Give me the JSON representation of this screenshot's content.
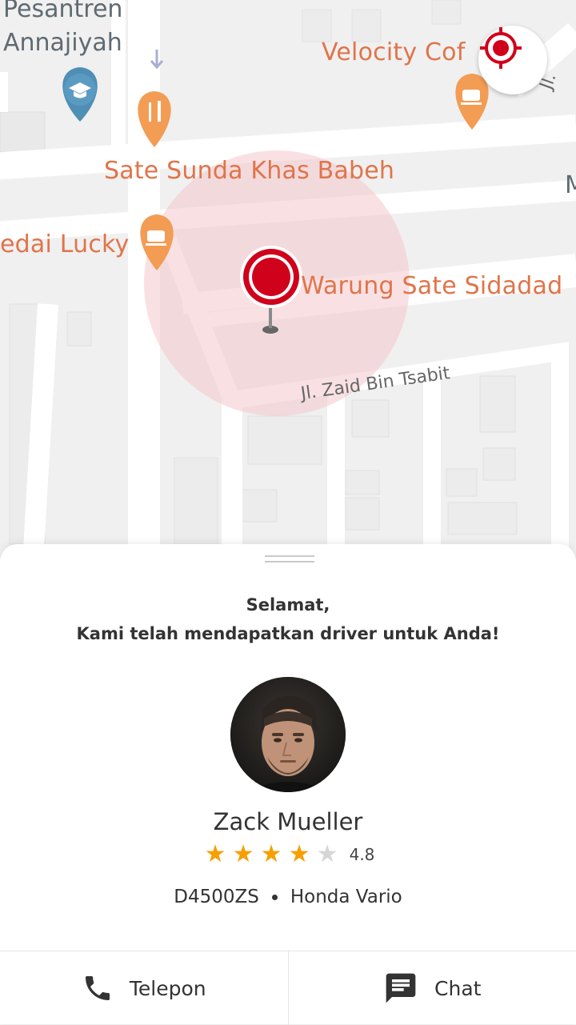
{
  "map": {
    "poi_labels": [
      "Pesantren",
      "Annajiyah",
      "Velocity Cof",
      "Sate Sunda Khas Babeh",
      "edai Lucky",
      "Warung Sate Sidadad",
      "M"
    ],
    "streets": [
      "Jl. Zaid Bin Tsabit",
      "Jl."
    ],
    "accent": "#d0021b",
    "poi_color": "#f39c54"
  },
  "locate_button": {
    "icon": "crosshair-icon"
  },
  "sheet": {
    "greeting_line1": "Selamat,",
    "greeting_line2": "Kami telah mendapatkan driver untuk Anda!",
    "driver": {
      "name": "Zack Mueller",
      "rating": "4.8",
      "stars_filled": 4,
      "stars_total": 5,
      "plate": "D4500ZS",
      "vehicle": "Honda Vario"
    },
    "actions": {
      "call_label": "Telepon",
      "chat_label": "Chat"
    }
  }
}
